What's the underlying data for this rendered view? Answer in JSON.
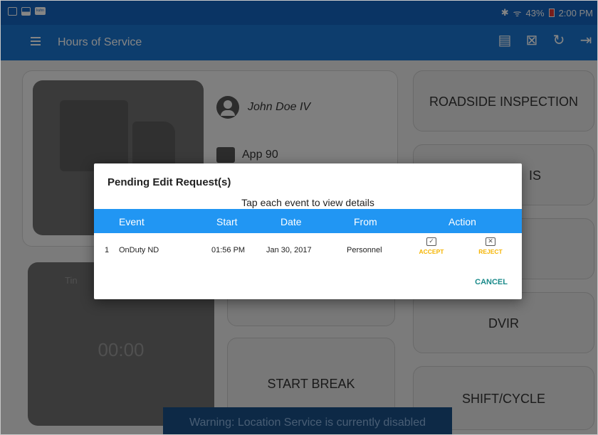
{
  "status_bar": {
    "bluetooth": "✱",
    "wifi": "ᯤ",
    "battery_text": "43%",
    "time": "2:00 PM",
    "notification_tag": "kuhn"
  },
  "app_bar": {
    "title": "Hours of Service",
    "icons": [
      "message-icon",
      "document-x-icon",
      "refresh-icon",
      "logout-icon"
    ]
  },
  "driver": {
    "name": "John Doe IV",
    "app": "App 90"
  },
  "tiles": {
    "roadside": "ROADSIDE INSPECTION",
    "partial": "IS",
    "dvir": "DVIR",
    "start_break": "START BREAK",
    "shift_cycle": "SHIFT/CYCLE"
  },
  "timer": {
    "label": "Tin",
    "value": "00:00"
  },
  "warning": "Warning: Location Service is currently disabled",
  "dialog": {
    "title": "Pending Edit Request(s)",
    "subtitle": "Tap each event to view details",
    "columns": {
      "event": "Event",
      "start": "Start",
      "date": "Date",
      "from": "From",
      "action": "Action"
    },
    "rows": [
      {
        "index": "1",
        "event": "OnDuty ND",
        "start": "01:56 PM",
        "date": "Jan 30, 2017",
        "from": "Personnel",
        "accept": "ACCEPT",
        "reject": "REJECT"
      }
    ],
    "cancel": "CANCEL"
  },
  "colors": {
    "status_bar": "#1565c0",
    "app_bar": "#1976d2",
    "table_header": "#2196f3",
    "action_text": "#f5b400",
    "cancel_text": "#1a8a8a"
  }
}
